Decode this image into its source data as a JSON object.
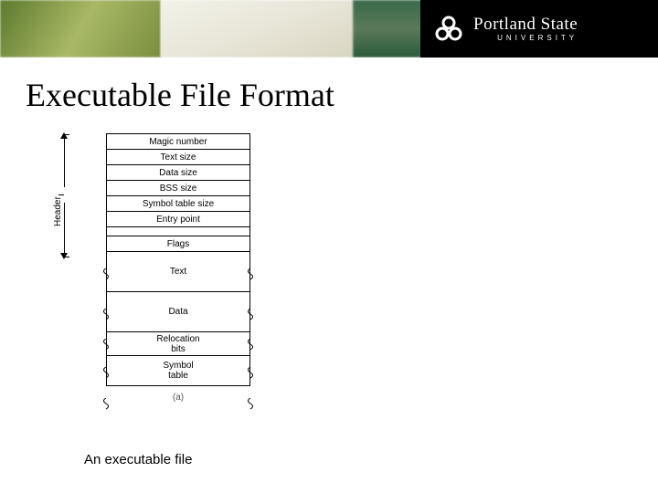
{
  "brand": {
    "name": "Portland State",
    "sub": "UNIVERSITY"
  },
  "slide": {
    "title": "Executable File Format",
    "caption_sub": "(a)",
    "caption_main": "An executable file",
    "header_label": "Header"
  },
  "file_layout": {
    "rows": [
      "Magic number",
      "Text size",
      "Data size",
      "BSS size",
      "Symbol table size",
      "Entry point",
      "Flags",
      "Text",
      "Data",
      "Relocation bits",
      "Symbol table"
    ]
  },
  "colors": {
    "header_bg": "#000000",
    "text": "#000000"
  }
}
